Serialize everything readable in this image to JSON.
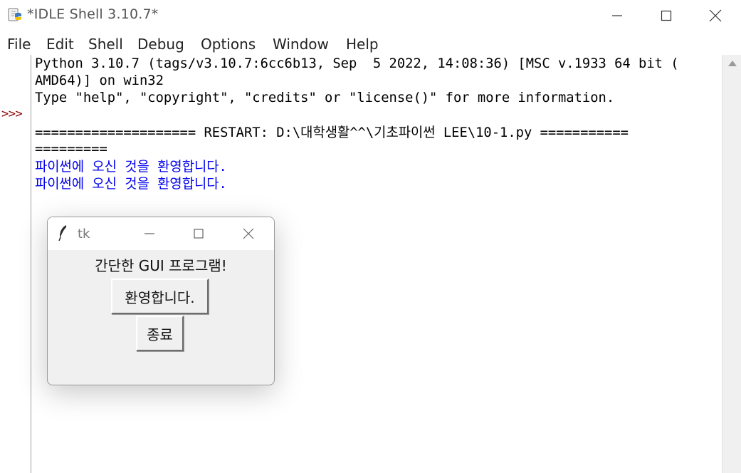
{
  "window": {
    "title": "*IDLE Shell 3.10.7*",
    "icon": "python-icon",
    "controls": [
      "minimize-icon",
      "maximize-icon",
      "close-icon"
    ]
  },
  "menu": {
    "items": [
      {
        "label": "File"
      },
      {
        "label": "Edit"
      },
      {
        "label": "Shell"
      },
      {
        "label": "Debug"
      },
      {
        "label": "Options"
      },
      {
        "label": "Window"
      },
      {
        "label": "Help"
      }
    ]
  },
  "shell": {
    "prompt": ">>>",
    "lines": [
      "Python 3.10.7 (tags/v3.10.7:6cc6b13, Sep  5 2022, 14:08:36) [MSC v.1933 64 bit (",
      "AMD64)] on win32",
      "Type \"help\", \"copyright\", \"credits\" or \"license()\" for more information.",
      "==================== RESTART: D:\\대학생활^^\\기초파이썬 LEE\\10-1.py ===========",
      "=========",
      "파이썬에 오신 것을 환영합니다.",
      "파이썬에 오신 것을 환영합니다."
    ],
    "colors": {
      "prompt": "#8b0000",
      "output": "#0000ee",
      "text": "#000000"
    }
  },
  "tk_window": {
    "title": "tk",
    "icon": "feather-icon",
    "label": "간단한 GUI 프로그램!",
    "buttons": {
      "welcome": "환영합니다.",
      "quit": "종료"
    }
  }
}
